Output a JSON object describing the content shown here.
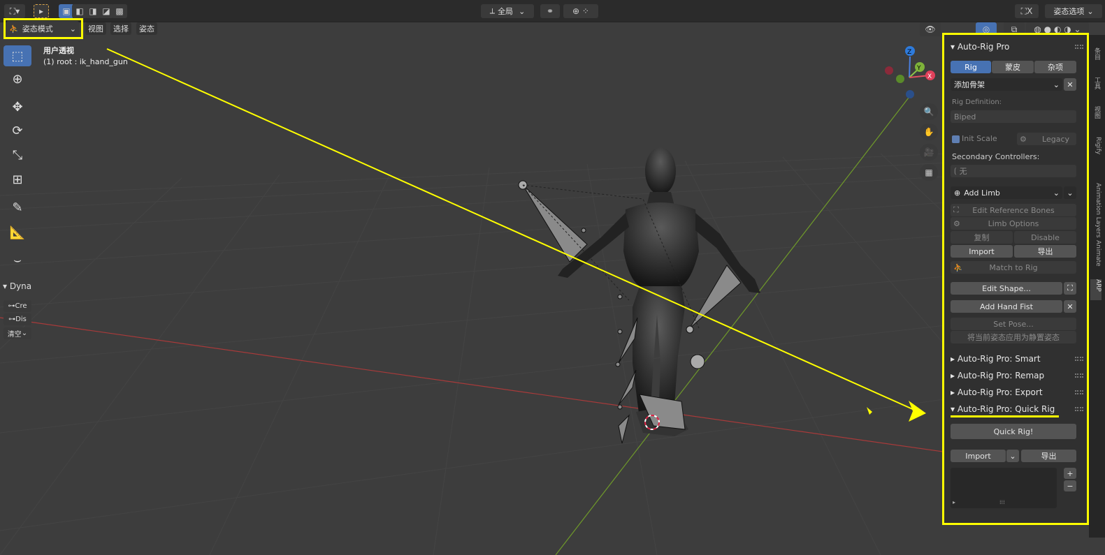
{
  "header": {
    "view_global": "全局",
    "pose_options": "姿态选项",
    "close_x": "X"
  },
  "header2": {
    "mode": "姿态模式",
    "menu_view": "视图",
    "menu_select": "选择",
    "menu_pose": "姿态"
  },
  "overlay": {
    "view_name": "用户透视",
    "active": "(1) root : ik_hand_gun"
  },
  "gizmo": {
    "z": "Z",
    "y": "Y",
    "x": "X"
  },
  "left_panel": {
    "title": "Dyna",
    "create": "Cre",
    "dissolve": "Dis",
    "clear": "清空"
  },
  "arp": {
    "title": "Auto-Rig Pro",
    "tabs": [
      "Rig",
      "蒙皮",
      "杂项"
    ],
    "add_armature": "添加骨架",
    "rig_def_label": "Rig Definition:",
    "rig_def_value": "Biped",
    "init_scale": "Init Scale",
    "legacy": "Legacy",
    "sec_ctrl_label": "Secondary Controllers:",
    "sec_ctrl_value": "无",
    "add_limb": "Add Limb",
    "edit_ref": "Edit Reference Bones",
    "limb_options": "Limb Options",
    "copy": "复制",
    "disable": "Disable",
    "import": "Import",
    "export": "导出",
    "match": "Match to Rig",
    "edit_shape": "Edit Shape...",
    "add_fist": "Add Hand Fist",
    "set_pose": "Set Pose...",
    "apply_rest": "将当前姿态应用为静置姿态",
    "smart": "Auto-Rig Pro: Smart",
    "remap": "Auto-Rig Pro: Remap",
    "export_sec": "Auto-Rig Pro: Export",
    "quick_rig": "Auto-Rig Pro: Quick Rig",
    "quick_btn": "Quick Rig!",
    "qr_import": "Import",
    "qr_export": "导出"
  },
  "side_tabs": [
    "条目",
    "工具",
    "视图",
    "ARP",
    "Animation Layers",
    "Rigify",
    "Animate"
  ],
  "colors": {
    "accent": "#4772b3",
    "yellow": "#ffff00",
    "axis_x": "#c44848",
    "axis_y": "#6f9a2a"
  }
}
